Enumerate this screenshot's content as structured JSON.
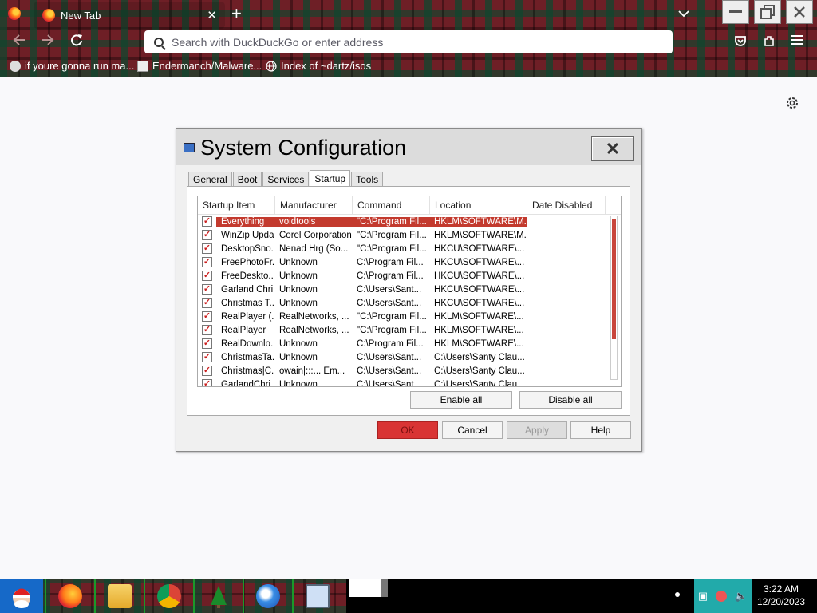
{
  "browser": {
    "tab_title": "New Tab",
    "tab_close": "✕",
    "new_tab": "+",
    "url_placeholder": "Search with DuckDuckGo or enter address",
    "bookmarks": [
      {
        "label": "if youre gonna run ma..."
      },
      {
        "label": "Endermanch/Malware..."
      },
      {
        "label": "Index of ~dartz/isos"
      }
    ]
  },
  "dialog": {
    "title": "System Configuration",
    "tabs": [
      "General",
      "Boot",
      "Services",
      "Startup",
      "Tools"
    ],
    "active_tab": "Startup",
    "columns": [
      "Startup Item",
      "Manufacturer",
      "Command",
      "Location",
      "Date Disabled"
    ],
    "rows": [
      {
        "item": "Everything",
        "manufacturer": "voidtools",
        "command": "\"C:\\Program Fil...",
        "location": "HKLM\\SOFTWARE\\M...",
        "date": "",
        "checked": true,
        "selected": true
      },
      {
        "item": "WinZip Upda...",
        "manufacturer": "Corel Corporation",
        "command": "\"C:\\Program Fil...",
        "location": "HKLM\\SOFTWARE\\M...",
        "date": "",
        "checked": true
      },
      {
        "item": "DesktopSno...",
        "manufacturer": "Nenad Hrg (So...",
        "command": "\"C:\\Program Fil...",
        "location": "HKCU\\SOFTWARE\\...",
        "date": "",
        "checked": true
      },
      {
        "item": "FreePhotoFr...",
        "manufacturer": "Unknown",
        "command": "C:\\Program Fil...",
        "location": "HKCU\\SOFTWARE\\...",
        "date": "",
        "checked": true
      },
      {
        "item": "FreeDeskto...",
        "manufacturer": "Unknown",
        "command": "C:\\Program Fil...",
        "location": "HKCU\\SOFTWARE\\...",
        "date": "",
        "checked": true
      },
      {
        "item": "Garland Chri...",
        "manufacturer": "Unknown",
        "command": "C:\\Users\\Sant...",
        "location": "HKCU\\SOFTWARE\\...",
        "date": "",
        "checked": true
      },
      {
        "item": "Christmas T...",
        "manufacturer": "Unknown",
        "command": "C:\\Users\\Sant...",
        "location": "HKCU\\SOFTWARE\\...",
        "date": "",
        "checked": true
      },
      {
        "item": "RealPlayer (...",
        "manufacturer": "RealNetworks, ...",
        "command": "\"C:\\Program Fil...",
        "location": "HKLM\\SOFTWARE\\...",
        "date": "",
        "checked": true
      },
      {
        "item": "RealPlayer",
        "manufacturer": "RealNetworks, ...",
        "command": "\"C:\\Program Fil...",
        "location": "HKLM\\SOFTWARE\\...",
        "date": "",
        "checked": true
      },
      {
        "item": "RealDownlo...",
        "manufacturer": "Unknown",
        "command": "C:\\Program Fil...",
        "location": "HKLM\\SOFTWARE\\...",
        "date": "",
        "checked": true
      },
      {
        "item": "ChristmasTa...",
        "manufacturer": "Unknown",
        "command": "C:\\Users\\Sant...",
        "location": "C:\\Users\\Santy Clau...",
        "date": "",
        "checked": true
      },
      {
        "item": "Christmas|C...",
        "manufacturer": "owain|:::... Em...",
        "command": "C:\\Users\\Sant...",
        "location": "C:\\Users\\Santy Clau...",
        "date": "",
        "checked": true
      },
      {
        "item": "GarlandChri...",
        "manufacturer": "Unknown",
        "command": "C:\\Users\\Sant...",
        "location": "C:\\Users\\Santy Clau...",
        "date": "",
        "checked": true
      }
    ],
    "enable_all": "Enable all",
    "disable_all": "Disable all",
    "ok": "OK",
    "cancel": "Cancel",
    "apply": "Apply",
    "help": "Help"
  },
  "taskbar": {
    "time": "3:22 AM",
    "date": "12/20/2023"
  },
  "colors": {
    "selection": "#c33a2e",
    "ok_button": "#d93434",
    "start": "#1669c8"
  }
}
